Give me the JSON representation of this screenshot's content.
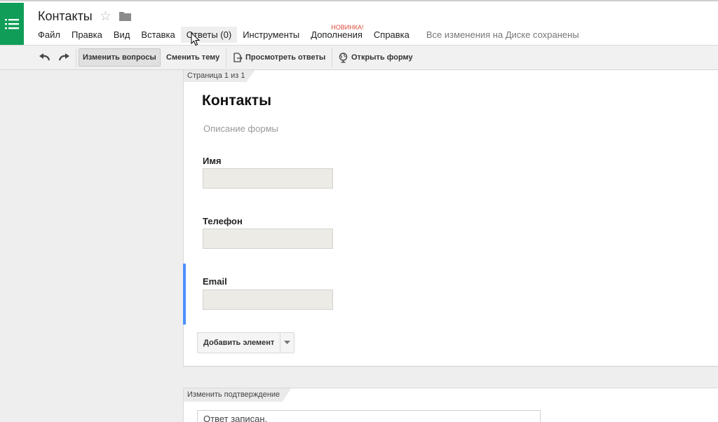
{
  "header": {
    "doc_title": "Контакты",
    "menu": [
      {
        "label": "Файл"
      },
      {
        "label": "Правка"
      },
      {
        "label": "Вид"
      },
      {
        "label": "Вставка"
      },
      {
        "label": "Ответы (0)"
      },
      {
        "label": "Инструменты"
      },
      {
        "label": "Дополнения",
        "badge": "НОВИНКА!"
      },
      {
        "label": "Справка"
      }
    ],
    "save_status": "Все изменения на Диске сохранены"
  },
  "toolbar": {
    "edit_questions": "Изменить вопросы",
    "change_theme": "Сменить тему",
    "view_responses": "Просмотреть ответы",
    "open_form": "Открыть форму"
  },
  "form": {
    "page_indicator": "Страница 1 из 1",
    "title": "Контакты",
    "description_placeholder": "Описание формы",
    "questions": [
      {
        "label": "Имя"
      },
      {
        "label": "Телефон"
      },
      {
        "label": "Email"
      }
    ],
    "add_item_label": "Добавить элемент"
  },
  "confirmation": {
    "tab_label": "Изменить подтверждение",
    "message": "Ответ записан."
  },
  "colors": {
    "app_green": "#0f9d58",
    "active_question_bar": "#4d90fe",
    "new_badge": "#dd4b39"
  }
}
